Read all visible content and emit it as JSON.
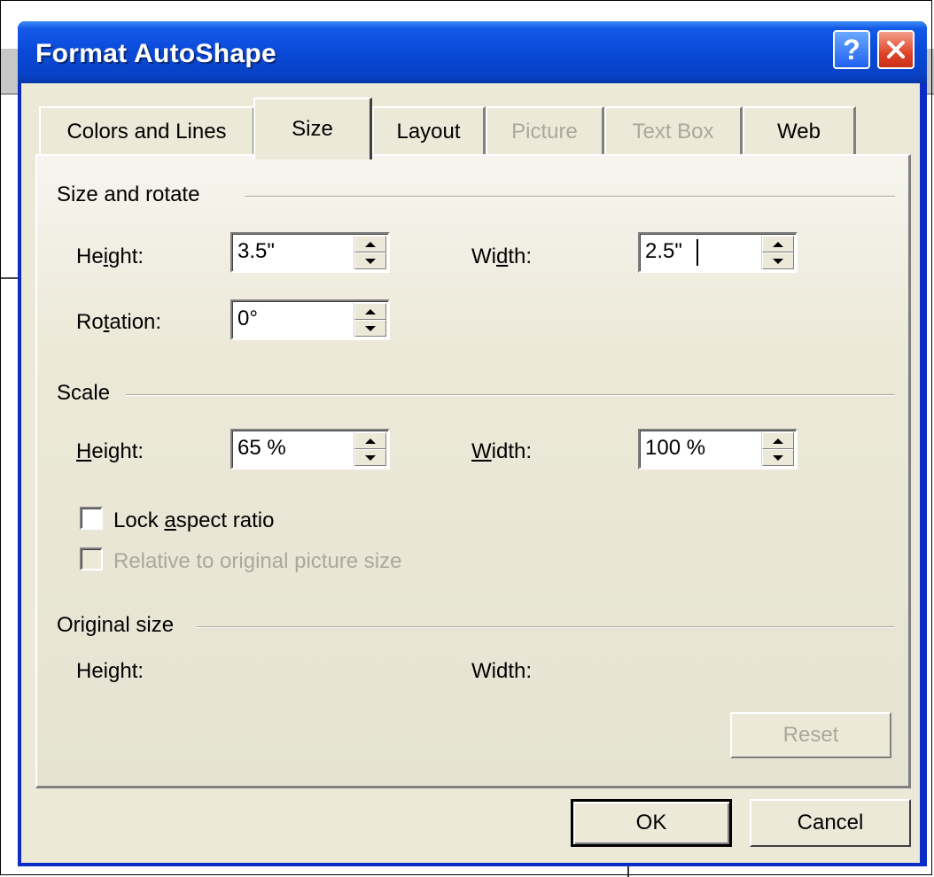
{
  "window": {
    "title": "Format AutoShape",
    "help_glyph": "?",
    "colors": {
      "titlebar": "#0a49d8",
      "close": "#e0442a",
      "face": "#ece9d8",
      "disabled_text": "#aca899"
    }
  },
  "tabs": [
    {
      "label": "Colors and Lines",
      "state": "normal"
    },
    {
      "label": "Size",
      "state": "active"
    },
    {
      "label": "Layout",
      "state": "normal"
    },
    {
      "label": "Picture",
      "state": "disabled"
    },
    {
      "label": "Text Box",
      "state": "disabled"
    },
    {
      "label": "Web",
      "state": "normal"
    }
  ],
  "size_rotate": {
    "heading": "Size and rotate",
    "height_label": [
      "He",
      "i",
      "ght:"
    ],
    "height_value": "3.5\"",
    "width_label": [
      "Wi",
      "d",
      "th:"
    ],
    "width_value": "2.5\"",
    "rotation_label": [
      "Ro",
      "t",
      "ation:"
    ],
    "rotation_value": "0°"
  },
  "scale": {
    "heading": "Scale",
    "height_label": [
      "",
      "H",
      "eight:"
    ],
    "height_value": "65 %",
    "width_label": [
      "",
      "W",
      "idth:"
    ],
    "width_value": "100 %",
    "lock_aspect_label": [
      "Lock ",
      "a",
      "spect ratio"
    ],
    "lock_aspect_checked": false,
    "relative_label": "Relative to original picture size",
    "relative_checked": false
  },
  "original_size": {
    "heading": "Original size",
    "height_label": "Height:",
    "width_label": "Width:"
  },
  "buttons": {
    "reset": "Reset",
    "ok": "OK",
    "cancel": "Cancel"
  }
}
